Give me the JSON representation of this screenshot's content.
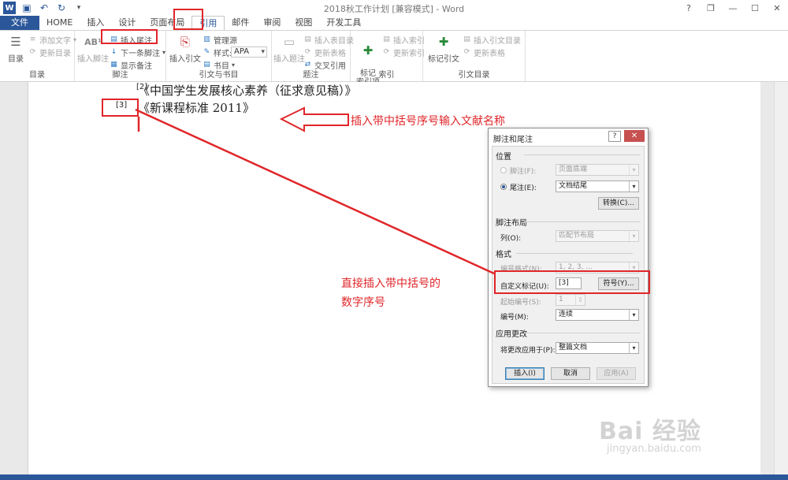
{
  "window": {
    "title": "2018秋工作计划 [兼容模式] - Word"
  },
  "window_controls": {
    "help": "?",
    "restore": "❐",
    "minimize": "—",
    "maximize": "☐",
    "close": "✕"
  },
  "tabs": [
    {
      "label": "文件"
    },
    {
      "label": "HOME"
    },
    {
      "label": "插入"
    },
    {
      "label": "设计"
    },
    {
      "label": "页面布局"
    },
    {
      "label": "引用"
    },
    {
      "label": "邮件"
    },
    {
      "label": "审阅"
    },
    {
      "label": "视图"
    },
    {
      "label": "开发工具"
    }
  ],
  "ribbon": {
    "toc": {
      "big": "目录",
      "add_text": "添加文字",
      "update": "更新目录",
      "group": "目录"
    },
    "footnote": {
      "big": "插入脚注",
      "ab": "AB¹",
      "insert_endnote": "插入尾注",
      "next_footnote": "下一条脚注",
      "show_notes": "显示备注",
      "group": "脚注"
    },
    "citation": {
      "big": "插入引文",
      "manage": "管理源",
      "style_label": "样式:",
      "style_value": "APA",
      "bibliography": "书目",
      "group": "引文与书目"
    },
    "caption": {
      "big": "插入题注",
      "insert_table": "插入表目录",
      "update_table": "更新表格",
      "crossref": "交叉引用",
      "group": "题注"
    },
    "index": {
      "big": "标记\n索引项",
      "insert": "插入索引",
      "update": "更新索引",
      "group": "索引"
    },
    "toa": {
      "big": "标记引文",
      "insert": "插入引文目录",
      "update": "更新表格",
      "group": "引文目录"
    }
  },
  "document": {
    "ref2_num": "[2]",
    "ref2_text": "《中国学生发展核心素养（征求意见稿）》",
    "ref3_num": "[3]",
    "ref3_text": "《新课程标准 2011》"
  },
  "annotations": {
    "arrow_text": "插入带中括号序号输入文献名称",
    "mid_text_1": "直接插入带中括号的",
    "mid_text_2": "数字序号"
  },
  "dialog": {
    "title": "脚注和尾注",
    "help": "?",
    "close": "✕",
    "position_section": "位置",
    "footnote_label": "脚注(F):",
    "footnote_value": "页面底端",
    "endnote_label": "尾注(E):",
    "endnote_value": "文档结尾",
    "convert_button": "转换(C)...",
    "layout_section": "脚注布局",
    "columns_label": "列(O):",
    "columns_value": "匹配节布局",
    "format_section": "格式",
    "number_format_label": "编号格式(N):",
    "number_format_value": "1, 2, 3, ...",
    "custom_mark_label": "自定义标记(U):",
    "custom_mark_value": "[3]",
    "symbol_button": "符号(Y)...",
    "start_at_label": "起始编号(S):",
    "start_at_value": "1",
    "numbering_label": "编号(M):",
    "numbering_value": "连续",
    "apply_section": "应用更改",
    "apply_to_label": "将更改应用于(P):",
    "apply_to_value": "整篇文档",
    "insert_button": "插入(I)",
    "cancel_button": "取消",
    "apply_button": "应用(A)"
  },
  "watermark": {
    "main": "Bai 经验",
    "sub": "jingyan.baidu.com"
  },
  "colors": {
    "accent": "#2b579a",
    "annotation_red": "#e0262a"
  }
}
